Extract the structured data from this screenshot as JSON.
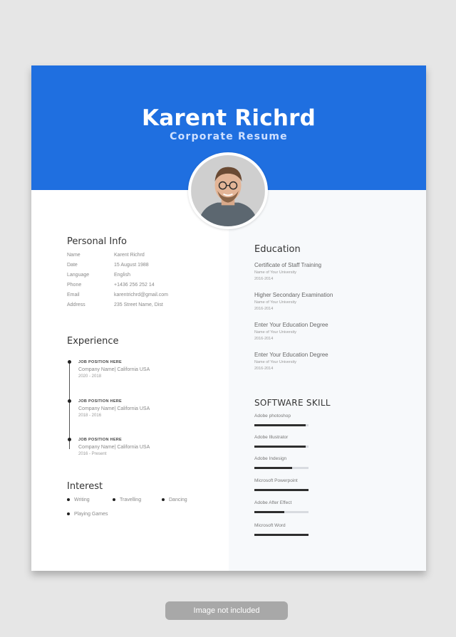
{
  "header": {
    "name": "Karent Richrd",
    "subtitle": "Corporate Resume"
  },
  "colors": {
    "accent": "#1f6fe0",
    "page_bg": "#e6e6e6"
  },
  "personal_info": {
    "title": "Personal Info",
    "rows": [
      {
        "label": "Name",
        "value": "Karent Richrd"
      },
      {
        "label": "Date",
        "value": "15 August 1988"
      },
      {
        "label": "Language",
        "value": "English"
      },
      {
        "label": "Phone",
        "value": "+1436 256 252 14"
      },
      {
        "label": "Email",
        "value": "karentrichrd@gmail.com"
      },
      {
        "label": "Address",
        "value": "235 Street Name, Dist"
      }
    ]
  },
  "experience": {
    "title": "Experience",
    "jobs": [
      {
        "position": "JOB POSITION HERE",
        "company": "Company Name| California USA",
        "years": "2020 - 2018"
      },
      {
        "position": "JOB POSITION HERE",
        "company": "Company Name| California USA",
        "years": "2018 - 2016"
      },
      {
        "position": "JOB POSITION HERE",
        "company": "Company Name| California USA",
        "years": "2016 - Present"
      }
    ]
  },
  "interest": {
    "title": "Interest",
    "items": [
      "Writing",
      "Travelling",
      "Dancing",
      "Playing Games"
    ]
  },
  "education": {
    "title": "Education",
    "items": [
      {
        "title": "Certificate of Staff Training",
        "school": "Name of Your University",
        "year": "2016-2014"
      },
      {
        "title": "Higher Secondary Examination",
        "school": "Name of Your University",
        "year": "2016-2014"
      },
      {
        "title": "Enter Your Education Degree",
        "school": "Name of Your University",
        "year": "2016-2014"
      },
      {
        "title": "Enter Your Education Degree",
        "school": "Name of Your University",
        "year": "2016-2014"
      }
    ]
  },
  "software_skill": {
    "title": "SOFTWARE SKILL",
    "items": [
      {
        "label": "Adobe photoshop",
        "level": 0.95
      },
      {
        "label": "Adobe Illustrator",
        "level": 0.95
      },
      {
        "label": "Adobe Indesign",
        "level": 0.7
      },
      {
        "label": "Microsoft Powerpoint",
        "level": 1.0
      },
      {
        "label": "Adobe After Effect",
        "level": 0.55
      },
      {
        "label": "Microsoft Word",
        "level": 1.0
      }
    ]
  },
  "footer": {
    "notice": "Image not included"
  },
  "icons": {
    "photo": "profile-photo"
  }
}
